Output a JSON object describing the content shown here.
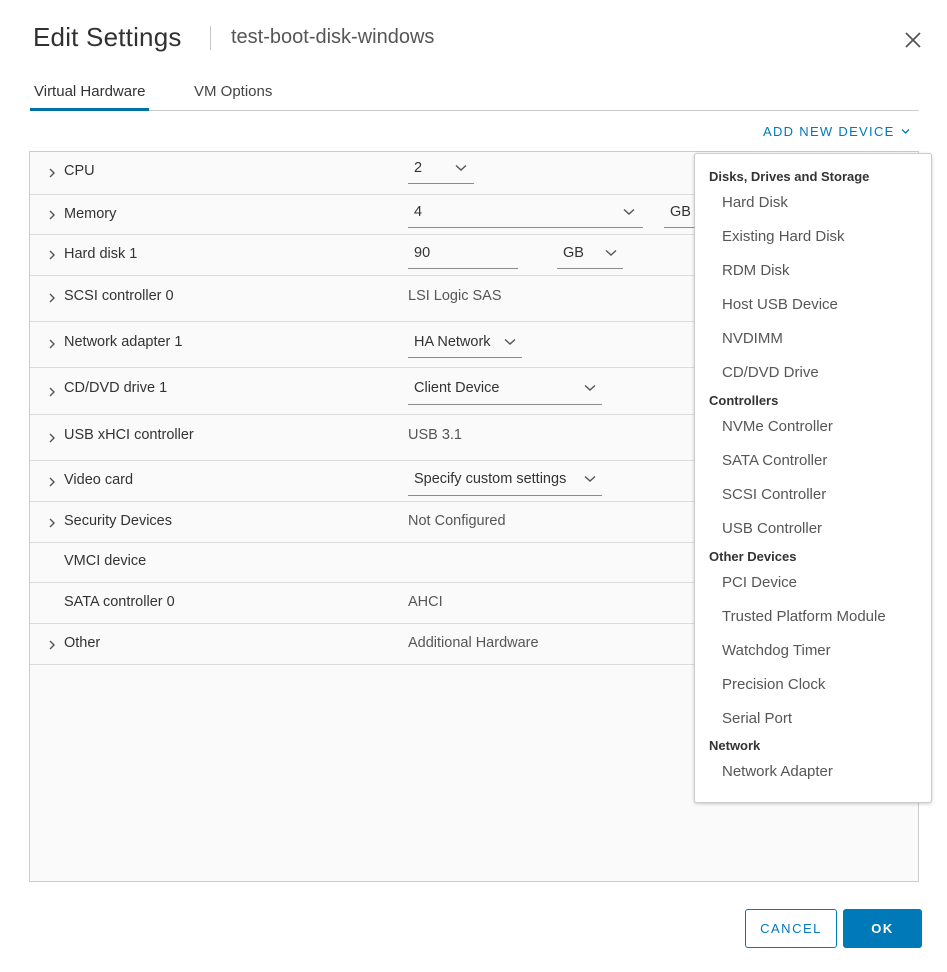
{
  "dialog": {
    "title": "Edit Settings",
    "vm_name": "test-boot-disk-windows"
  },
  "tabs": [
    {
      "label": "Virtual Hardware",
      "active": true
    },
    {
      "label": "VM Options",
      "active": false
    }
  ],
  "add_new_device": "ADD NEW DEVICE",
  "hardware": {
    "cpu": {
      "label": "CPU",
      "value": "2"
    },
    "memory": {
      "label": "Memory",
      "value": "4",
      "unit": "GB"
    },
    "hard_disk": {
      "label": "Hard disk 1",
      "value": "90",
      "unit": "GB"
    },
    "scsi": {
      "label": "SCSI controller 0",
      "value": "LSI Logic SAS"
    },
    "network": {
      "label": "Network adapter 1",
      "value": "HA Network"
    },
    "cddvd": {
      "label": "CD/DVD drive 1",
      "value": "Client Device"
    },
    "usb": {
      "label": "USB xHCI controller",
      "value": "USB 3.1"
    },
    "video": {
      "label": "Video card",
      "value": "Specify custom settings"
    },
    "security": {
      "label": "Security Devices",
      "value": "Not Configured"
    },
    "vmci": {
      "label": "VMCI device"
    },
    "sata": {
      "label": "SATA controller 0",
      "value": "AHCI"
    },
    "other": {
      "label": "Other",
      "value": "Additional Hardware"
    }
  },
  "device_menu": {
    "disks_header": "Disks, Drives and Storage",
    "disks": [
      "Hard Disk",
      "Existing Hard Disk",
      "RDM Disk",
      "Host USB Device",
      "NVDIMM",
      "CD/DVD Drive"
    ],
    "controllers_header": "Controllers",
    "controllers": [
      "NVMe Controller",
      "SATA Controller",
      "SCSI Controller",
      "USB Controller"
    ],
    "other_header": "Other Devices",
    "other": [
      "PCI Device",
      "Trusted Platform Module",
      "Watchdog Timer",
      "Precision Clock",
      "Serial Port"
    ],
    "network_header": "Network",
    "network": [
      "Network Adapter"
    ]
  },
  "buttons": {
    "cancel": "CANCEL",
    "ok": "OK"
  },
  "colors": {
    "accent": "#0079b8",
    "tab_underline": "#0072a3"
  }
}
